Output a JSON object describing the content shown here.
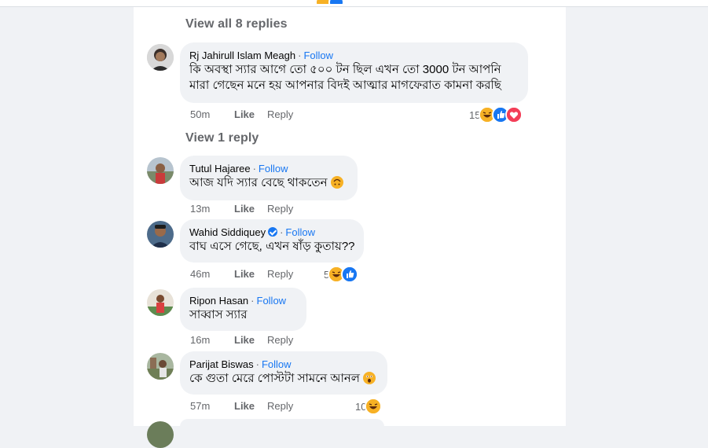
{
  "replies_links": {
    "view_all": "View all 8 replies",
    "view_one": "View 1 reply"
  },
  "labels": {
    "follow": "Follow",
    "like": "Like",
    "reply": "Reply"
  },
  "comments": [
    {
      "name": "Rj Jahirull Islam Meagh",
      "text_line1": "কি অবস্থা স্যার আগে তো ৫০০ টন ছিল এখন তো 3000 টন আপনি",
      "text_line2": "মারা গেছেন মনে হয় আপনার বিদই আত্মার মাগফেরাত কামনা করছি",
      "time": "50m",
      "reactions_count": "15",
      "reaction_icons": [
        "haha-icon",
        "like-icon",
        "love-icon"
      ]
    },
    {
      "name": "Tutul Hajaree",
      "text": "আজ যদি স্যার বেছে থাকতেন",
      "text_emoji": "upside-down-face",
      "time": "13m"
    },
    {
      "name": "Wahid Siddiquey",
      "verified": true,
      "text": "বাঘ এসে গেছে, এখন ষাঁড় কুতায়??",
      "time": "46m",
      "reactions_count": "5",
      "reaction_icons": [
        "haha-icon",
        "like-icon"
      ]
    },
    {
      "name": "Ripon Hasan",
      "text": "সাব্বাস স্যার",
      "time": "16m"
    },
    {
      "name": "Parijat Biswas",
      "text": "কে গুতা মেরে পোস্টটা সামনে আনল",
      "text_emoji": "astonished-face",
      "time": "57m",
      "reactions_count": "10",
      "reaction_icons": [
        "haha-icon"
      ]
    }
  ],
  "colors": {
    "link_blue": "#1877f2",
    "meta_gray": "#65676b",
    "bubble_bg": "#f0f2f5",
    "page_bg": "#f0f2f5"
  }
}
